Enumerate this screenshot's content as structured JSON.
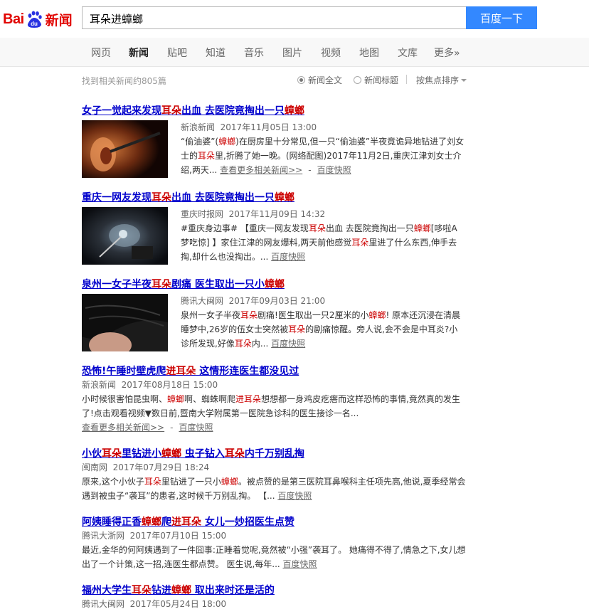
{
  "header": {
    "logo_text_left": "Bai",
    "logo_text_paw": "du",
    "logo_text_right": "新闻",
    "search_value": "耳朵进蟑螂",
    "search_button": "百度一下"
  },
  "nav": {
    "tabs": [
      {
        "label": "网页"
      },
      {
        "label": "新闻"
      },
      {
        "label": "贴吧"
      },
      {
        "label": "知道"
      },
      {
        "label": "音乐"
      },
      {
        "label": "图片"
      },
      {
        "label": "视频"
      },
      {
        "label": "地图"
      },
      {
        "label": "文库"
      },
      {
        "label": "更多»"
      }
    ],
    "active": "新闻"
  },
  "toolbar": {
    "count_text": "找到相关新闻约805篇",
    "opt_fulltext": "新闻全文",
    "opt_title": "新闻标题",
    "sort_label": "按焦点排序"
  },
  "results": [
    {
      "title_parts": [
        "女子一觉起来发现",
        "耳朵",
        "出血 去医院竟掏出一只",
        "蟑螂"
      ],
      "source": "新浪新闻",
      "time": "2017年11月05日 13:00",
      "snippet_parts": [
        "“偷油婆”(",
        "蟑螂",
        ")在厨房里十分常见,但一只“偷油婆”半夜竟诡异地钻进了刘女士的",
        "耳朵",
        "里,折腾了她一晚。(网络配图)2017年11月2日,重庆江津刘女士介绍,两天..."
      ],
      "more_link": "查看更多相关新闻>>",
      "cache_link": "百度快照"
    },
    {
      "title_parts": [
        "重庆一网友发现",
        "耳朵",
        "出血 去医院竟掏出一只",
        "蟑螂"
      ],
      "source": "重庆时报网",
      "time": "2017年11月09日 14:32",
      "snippet_parts": [
        "#重庆身边事# 【重庆一网友发现",
        "耳朵",
        "出血 去医院竟掏出一只",
        "蟑螂",
        "[哆啦A梦吃惊] 】家住江津的网友爆料,两天前他感觉",
        "耳朵",
        "里进了什么东西,伸手去掏,却什么也没掏出。..."
      ],
      "cache_link": "百度快照"
    },
    {
      "title_parts": [
        "泉州一女子半夜",
        "耳朵",
        "剧痛 医生取出一只小",
        "蟑螂"
      ],
      "source": "腾讯大闽网",
      "time": "2017年09月03日 21:00",
      "snippet_parts": [
        "泉州一女子半夜",
        "耳朵",
        "剧痛!医生取出一只2厘米的小",
        "蟑螂",
        "! 原本还沉浸在清晨睡梦中,26岁的伍女士突然被",
        "耳朵",
        "的剧痛惊醒。旁人说,会不会是中耳炎?小诊所发现,好像",
        "耳朵",
        "内..."
      ],
      "cache_link": "百度快照"
    },
    {
      "title_parts": [
        "恐怖!午睡时壁虎爬",
        "进耳朵",
        " 这情形连医生都没见过"
      ],
      "source": "新浪新闻",
      "time": "2017年08月18日 15:00",
      "snippet_parts": [
        "小时候很害怕昆虫啊、",
        "蟑螂",
        "啊、蜘蛛啊爬",
        "进耳朵",
        "想想都一身鸡皮疙瘩而这样恐怖的事情,竟然真的发生了!点击观看视频▼数日前,暨南大学附属第一医院急诊科的医生接诊一名..."
      ],
      "more_link": "查看更多相关新闻>>",
      "cache_link": "百度快照"
    },
    {
      "title_parts": [
        "小伙",
        "耳朵",
        "里钻进小",
        "蟑螂",
        " 虫子钻入",
        "耳朵",
        "内千万别乱掏"
      ],
      "source": "闽南网",
      "time": "2017年07月29日 18:24",
      "snippet_parts": [
        "原来,这个小伙子",
        "耳朵",
        "里钻进了一只小",
        "蟑螂",
        "。被点赞的是第三医院耳鼻喉科主任项先高,他说,夏季经常会遇到被虫子“袭耳”的患者,这时候千万别乱掏。 【..."
      ],
      "cache_link": "百度快照"
    },
    {
      "title_parts": [
        "阿姨睡得正香",
        "蟑螂",
        "爬",
        "进耳朵",
        " 女儿一妙招医生点赞"
      ],
      "source": "腾讯大浙网",
      "time": "2017年07月10日 15:00",
      "snippet_parts": [
        "最近,金华的何阿姨遇到了一件囧事:正睡着觉呢,竟然被“小强”袭耳了。 她痛得不得了,情急之下,女儿想出了一个计策,这一招,连医生都点赞。 医生说,每年..."
      ],
      "cache_link": "百度快照"
    },
    {
      "title_parts": [
        "福州大学生",
        "耳朵",
        "钻进",
        "蟑螂",
        " 取出来时还是活的"
      ],
      "source": "腾讯大闽网",
      "time": "2017年05月24日 18:00"
    }
  ]
}
